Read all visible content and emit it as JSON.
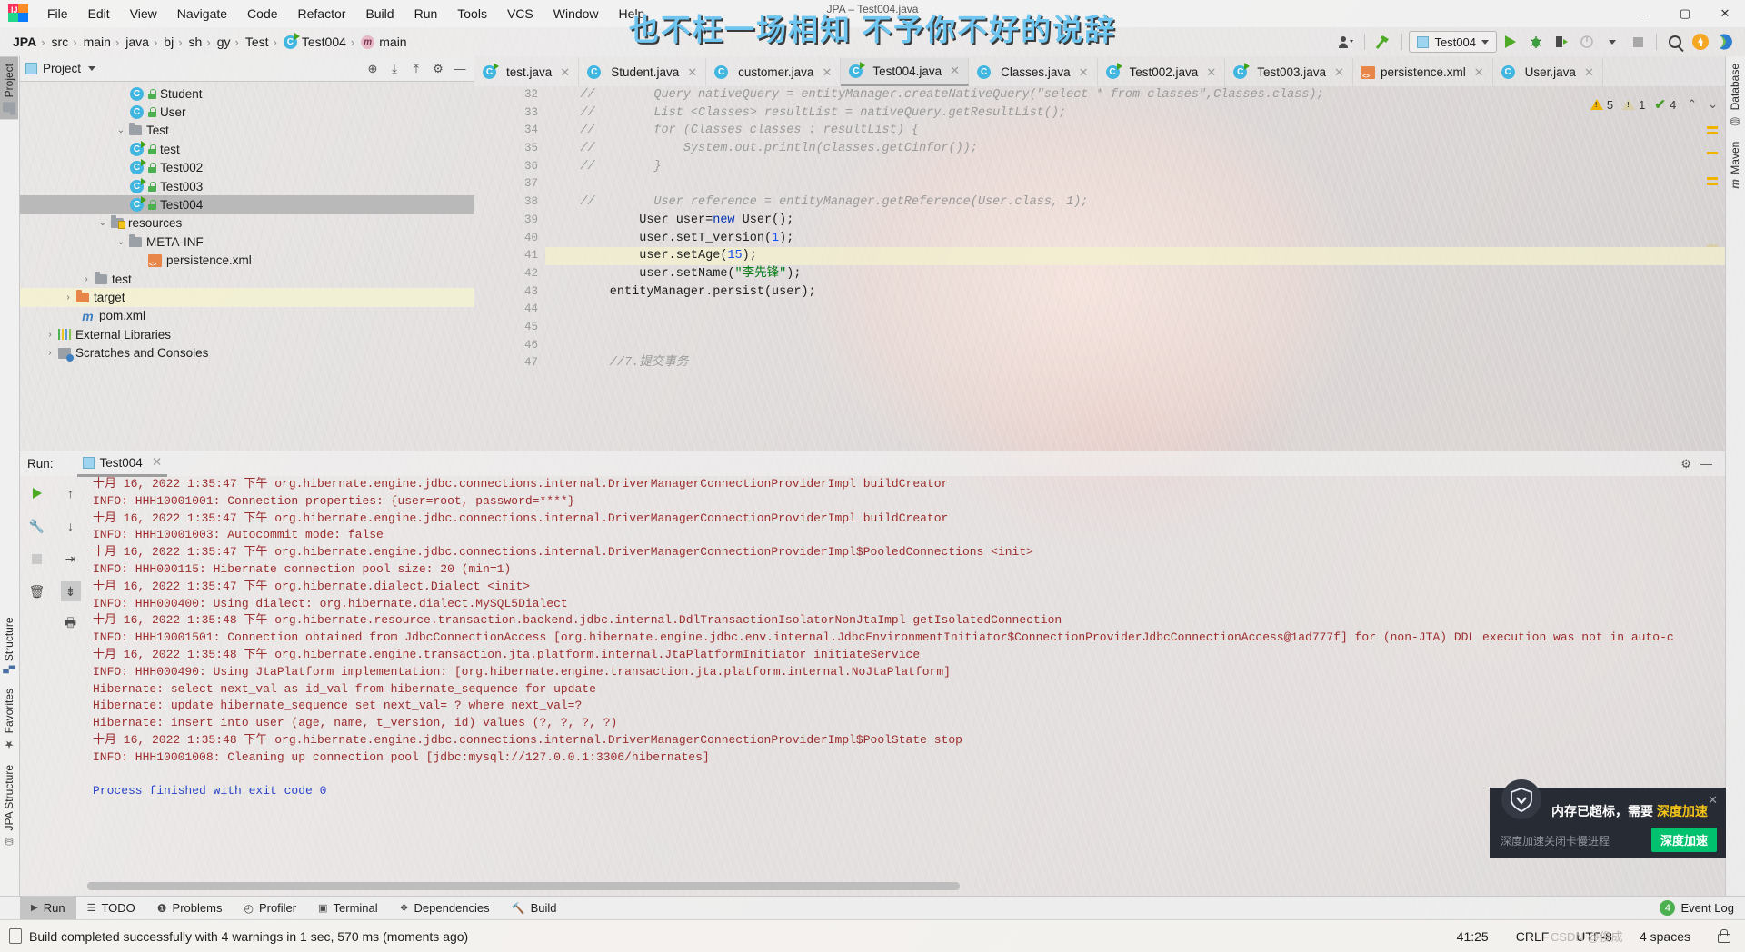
{
  "window": {
    "caption": "JPA – Test004.java",
    "subtitle_overlay": "也不枉一场相知 不予你不好的说辞",
    "minimize": "–",
    "maximize": "▢",
    "close": "✕"
  },
  "menubar": {
    "logo": "intellij-idea-logo",
    "items": [
      "File",
      "Edit",
      "View",
      "Navigate",
      "Code",
      "Refactor",
      "Build",
      "Run",
      "Tools",
      "VCS",
      "Window",
      "Help"
    ]
  },
  "breadcrumb": {
    "items": [
      {
        "label": "JPA",
        "icon": ""
      },
      {
        "label": "src",
        "icon": ""
      },
      {
        "label": "main",
        "icon": ""
      },
      {
        "label": "java",
        "icon": ""
      },
      {
        "label": "bj",
        "icon": ""
      },
      {
        "label": "sh",
        "icon": ""
      },
      {
        "label": "gy",
        "icon": ""
      },
      {
        "label": "Test",
        "icon": ""
      },
      {
        "label": "Test004",
        "icon": "class-run-icon"
      },
      {
        "label": "main",
        "icon": "method-icon"
      }
    ]
  },
  "toolbar": {
    "user_icon": "user-dropdown-icon",
    "build_icon": "build-hammer-icon",
    "run_config": "Test004",
    "run_label": "Run",
    "debug_label": "Debug",
    "run_coverage_label": "Run with Coverage",
    "profile_label": "Profile",
    "stop_label": "Stop",
    "search_label": "Search Everywhere",
    "update_label": "Update Project",
    "notification_label": "Notifications"
  },
  "left_strip": [
    {
      "label": "Project",
      "icon": "project-folder-icon",
      "active": true
    },
    {
      "label": "Structure",
      "icon": "structure-icon",
      "active": false
    },
    {
      "label": "Favorites",
      "icon": "star-icon",
      "active": false
    },
    {
      "label": "JPA Structure",
      "icon": "jpa-structure-icon",
      "active": false
    }
  ],
  "right_strip": [
    {
      "label": "Database",
      "icon": "database-icon"
    },
    {
      "label": "Maven",
      "icon": "maven-m-icon"
    }
  ],
  "project_panel": {
    "title": "Project",
    "icons": [
      "locate-icon",
      "expand-all-icon",
      "collapse-all-icon",
      "settings-gear-icon",
      "hide-icon"
    ],
    "tree": [
      {
        "depth": 4,
        "label": "Student",
        "icon": "class-icon",
        "lock": true
      },
      {
        "depth": 4,
        "label": "User",
        "icon": "class-icon",
        "lock": true
      },
      {
        "depth": 3,
        "label": "Test",
        "icon": "package-folder-icon",
        "arrow": "v"
      },
      {
        "depth": 4,
        "label": "test",
        "icon": "class-run-icon",
        "lock": true
      },
      {
        "depth": 4,
        "label": "Test002",
        "icon": "class-run-icon",
        "lock": true
      },
      {
        "depth": 4,
        "label": "Test003",
        "icon": "class-run-icon",
        "lock": true
      },
      {
        "depth": 4,
        "label": "Test004",
        "icon": "class-run-icon",
        "lock": true,
        "selected": true
      },
      {
        "depth": 3,
        "label": "resources",
        "icon": "resources-folder-icon",
        "arrow": "v"
      },
      {
        "depth": 4,
        "label": "META-INF",
        "icon": "folder-icon",
        "arrow": "v"
      },
      {
        "depth": 5,
        "label": "persistence.xml",
        "icon": "xml-icon"
      },
      {
        "depth": 3,
        "label": "test",
        "icon": "folder-icon",
        "arrow": ">"
      },
      {
        "depth": 2,
        "label": "target",
        "icon": "orange-folder-icon",
        "arrow": ">",
        "highlight": true
      },
      {
        "depth": 3,
        "label": "pom.xml",
        "icon": "maven-m-icon"
      },
      {
        "depth": 1,
        "label": "External Libraries",
        "icon": "libraries-icon",
        "arrow": ">"
      },
      {
        "depth": 1,
        "label": "Scratches and Consoles",
        "icon": "scratches-icon",
        "arrow": ">"
      }
    ]
  },
  "editor": {
    "tabs": [
      {
        "label": "test.java",
        "icon": "class-run-icon",
        "active": false
      },
      {
        "label": "Student.java",
        "icon": "class-icon",
        "active": false
      },
      {
        "label": "customer.java",
        "icon": "class-icon",
        "active": false
      },
      {
        "label": "Test004.java",
        "icon": "class-run-icon",
        "active": true
      },
      {
        "label": "Classes.java",
        "icon": "class-icon",
        "active": false
      },
      {
        "label": "Test002.java",
        "icon": "class-run-icon",
        "active": false
      },
      {
        "label": "Test003.java",
        "icon": "class-run-icon",
        "active": false
      },
      {
        "label": "persistence.xml",
        "icon": "xml-icon",
        "active": false
      },
      {
        "label": "User.java",
        "icon": "class-icon",
        "active": false
      }
    ],
    "inspections": {
      "warnings": "5",
      "weak_warnings": "1",
      "typos": "4",
      "up_arrow": "⌃",
      "down_arrow": "⌄"
    },
    "first_line_number": 32,
    "current_line": 41,
    "lines": [
      {
        "n": 32,
        "segs": [
          {
            "t": "    //        Query nativeQuery = entityManager.createNativeQuery(\"select * from classes\",Classes.class);",
            "c": "cmt"
          }
        ]
      },
      {
        "n": 33,
        "segs": [
          {
            "t": "    //        List <Classes> resultList = nativeQuery.getResultList();",
            "c": "cmt"
          }
        ]
      },
      {
        "n": 34,
        "segs": [
          {
            "t": "    //        for (Classes classes : resultList) {",
            "c": "cmt"
          }
        ]
      },
      {
        "n": 35,
        "segs": [
          {
            "t": "    //            System.out.println(classes.getCinfor());",
            "c": "cmt"
          }
        ]
      },
      {
        "n": 36,
        "segs": [
          {
            "t": "    //        }",
            "c": "cmt"
          }
        ]
      },
      {
        "n": 37,
        "segs": [
          {
            "t": "",
            "c": ""
          }
        ]
      },
      {
        "n": 38,
        "segs": [
          {
            "t": "    //        User reference = entityManager.getReference(User.class, 1);",
            "c": "cmt"
          }
        ]
      },
      {
        "n": 39,
        "segs": [
          {
            "t": "            User user=",
            "c": ""
          },
          {
            "t": "new",
            "c": "kw"
          },
          {
            "t": " User();",
            "c": ""
          }
        ]
      },
      {
        "n": 40,
        "segs": [
          {
            "t": "            user.setT_version(",
            "c": ""
          },
          {
            "t": "1",
            "c": "num"
          },
          {
            "t": ");",
            "c": ""
          }
        ]
      },
      {
        "n": 41,
        "segs": [
          {
            "t": "            user.setAge(",
            "c": ""
          },
          {
            "t": "15",
            "c": "num"
          },
          {
            "t": ");",
            "c": ""
          }
        ],
        "current": true
      },
      {
        "n": 42,
        "segs": [
          {
            "t": "            user.setName(",
            "c": ""
          },
          {
            "t": "\"李先锋\"",
            "c": "str"
          },
          {
            "t": ");",
            "c": ""
          }
        ]
      },
      {
        "n": 43,
        "segs": [
          {
            "t": "        entityManager.persist(user);",
            "c": ""
          }
        ]
      },
      {
        "n": 44,
        "segs": [
          {
            "t": "",
            "c": ""
          }
        ]
      },
      {
        "n": 45,
        "segs": [
          {
            "t": "",
            "c": ""
          }
        ]
      },
      {
        "n": 46,
        "segs": [
          {
            "t": "",
            "c": ""
          }
        ]
      },
      {
        "n": 47,
        "segs": [
          {
            "t": "        //7.提交事务",
            "c": "cmt"
          }
        ]
      }
    ]
  },
  "run_panel": {
    "label": "Run:",
    "tab": "Test004",
    "gutter_icons": [
      "rerun-icon",
      "settings-wrench-icon",
      "stop-icon",
      "trash-icon",
      "up-icon",
      "down-icon",
      "soft-wrap-icon",
      "scroll-to-end-icon",
      "print-icon"
    ],
    "header_icons": [
      "settings-gear-icon",
      "hide-icon"
    ],
    "output": [
      {
        "t": "十月 16, 2022 1:35:47 下午 org.hibernate.engine.jdbc.connections.internal.DriverManagerConnectionProviderImpl buildCreator",
        "c": "red"
      },
      {
        "t": "INFO: HHH10001001: Connection properties: {user=root, password=****}",
        "c": "red"
      },
      {
        "t": "十月 16, 2022 1:35:47 下午 org.hibernate.engine.jdbc.connections.internal.DriverManagerConnectionProviderImpl buildCreator",
        "c": "red"
      },
      {
        "t": "INFO: HHH10001003: Autocommit mode: false",
        "c": "red"
      },
      {
        "t": "十月 16, 2022 1:35:47 下午 org.hibernate.engine.jdbc.connections.internal.DriverManagerConnectionProviderImpl$PooledConnections <init>",
        "c": "red"
      },
      {
        "t": "INFO: HHH000115: Hibernate connection pool size: 20 (min=1)",
        "c": "red"
      },
      {
        "t": "十月 16, 2022 1:35:47 下午 org.hibernate.dialect.Dialect <init>",
        "c": "red"
      },
      {
        "t": "INFO: HHH000400: Using dialect: org.hibernate.dialect.MySQL5Dialect",
        "c": "red"
      },
      {
        "t": "十月 16, 2022 1:35:48 下午 org.hibernate.resource.transaction.backend.jdbc.internal.DdlTransactionIsolatorNonJtaImpl getIsolatedConnection",
        "c": "red"
      },
      {
        "t": "INFO: HHH10001501: Connection obtained from JdbcConnectionAccess [org.hibernate.engine.jdbc.env.internal.JdbcEnvironmentInitiator$ConnectionProviderJdbcConnectionAccess@1ad777f] for (non-JTA) DDL execution was not in auto-c",
        "c": "red"
      },
      {
        "t": "十月 16, 2022 1:35:48 下午 org.hibernate.engine.transaction.jta.platform.internal.JtaPlatformInitiator initiateService",
        "c": "red"
      },
      {
        "t": "INFO: HHH000490: Using JtaPlatform implementation: [org.hibernate.engine.transaction.jta.platform.internal.NoJtaPlatform]",
        "c": "red"
      },
      {
        "t": "Hibernate: select next_val as id_val from hibernate_sequence for update",
        "c": "red"
      },
      {
        "t": "Hibernate: update hibernate_sequence set next_val= ? where next_val=?",
        "c": "red"
      },
      {
        "t": "Hibernate: insert into user (age, name, t_version, id) values (?, ?, ?, ?)",
        "c": "red"
      },
      {
        "t": "十月 16, 2022 1:35:48 下午 org.hibernate.engine.jdbc.connections.internal.DriverManagerConnectionProviderImpl$PoolState stop",
        "c": "red"
      },
      {
        "t": "INFO: HHH10001008: Cleaning up connection pool [jdbc:mysql://127.0.0.1:3306/hibernates]",
        "c": "red"
      },
      {
        "t": "",
        "c": "red"
      },
      {
        "t": "Process finished with exit code 0",
        "c": "blue"
      }
    ]
  },
  "bottom_bar": {
    "tabs": [
      {
        "label": "Run",
        "icon": "run-play-icon",
        "active": true
      },
      {
        "label": "TODO",
        "icon": "todo-list-icon",
        "active": false
      },
      {
        "label": "Problems",
        "icon": "problems-icon",
        "active": false
      },
      {
        "label": "Profiler",
        "icon": "profiler-icon",
        "active": false
      },
      {
        "label": "Terminal",
        "icon": "terminal-icon",
        "active": false
      },
      {
        "label": "Dependencies",
        "icon": "dependencies-icon",
        "active": false
      },
      {
        "label": "Build",
        "icon": "build-hammer-icon",
        "active": false
      }
    ],
    "event_log": {
      "label": "Event Log",
      "count": "4"
    }
  },
  "status_bar": {
    "message": "Build completed successfully with 4 warnings in 1 sec, 570 ms (moments ago)",
    "caret": "41:25",
    "line_separator": "CRLF",
    "encoding": "UTF-8",
    "indent": "4 spaces",
    "lock_icon": "read-only-lock-icon",
    "watermark": "CSDN @俊成"
  },
  "toast": {
    "icon": "shield-icon",
    "title_prefix": "内存已超标，需要 ",
    "title_highlight": "深度加速",
    "subtitle": "深度加速关闭卡慢进程",
    "button": "深度加速",
    "close": "✕"
  }
}
